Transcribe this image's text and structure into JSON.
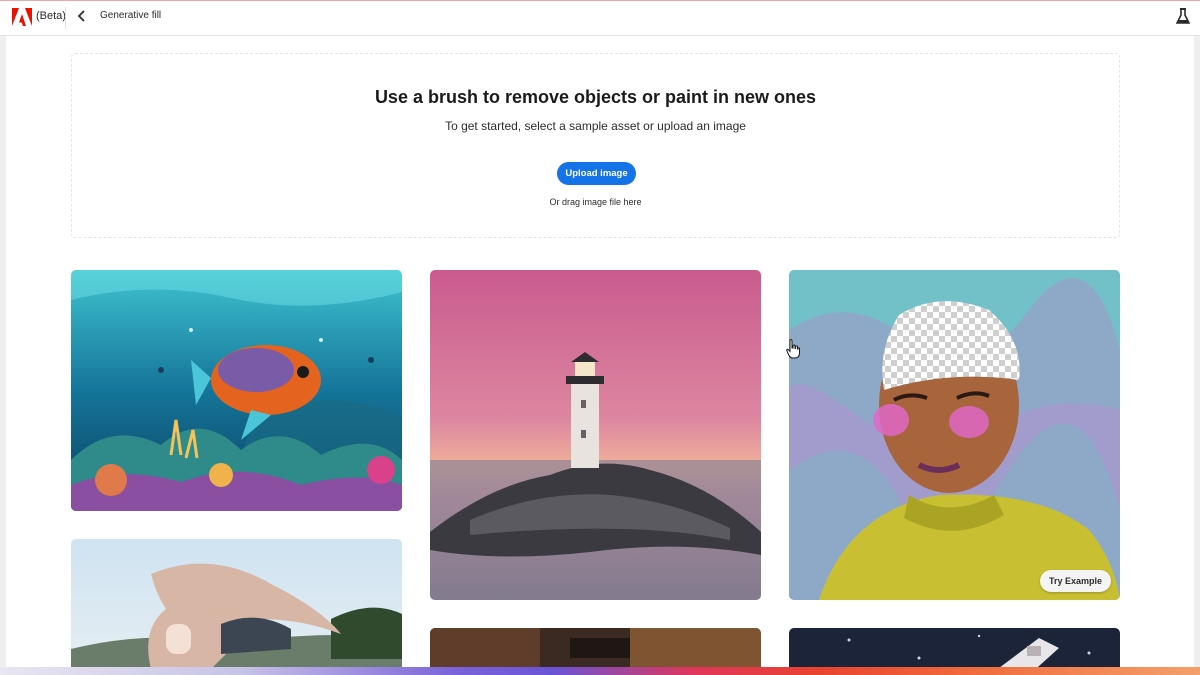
{
  "header": {
    "beta_label": "(Beta)",
    "breadcrumb": "Generative fill",
    "icons": [
      "adobe-logo",
      "chevron-left-icon",
      "flask-icon"
    ]
  },
  "dropzone": {
    "title": "Use a brush to remove objects or paint in new ones",
    "subtitle": "To get started, select a sample asset or upload an image",
    "upload_button": "Upload image",
    "drag_hint": "Or drag image file here"
  },
  "gallery": {
    "items": [
      "underwater-fish",
      "lighthouse",
      "portrait",
      "modern-house",
      "sample-5",
      "sample-6"
    ],
    "try_example_label": "Try Example"
  },
  "colors": {
    "accent": "#1473e6",
    "adobe_red": "#eb1000"
  }
}
